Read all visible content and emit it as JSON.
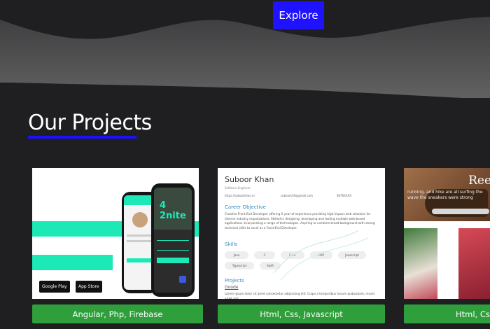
{
  "hero": {
    "explore_label": "Explore"
  },
  "projects": {
    "title": "Our Projects",
    "cards": [
      {
        "tech_label": "Angular, Php, Firebase",
        "app_name": "4 2nite",
        "badges": [
          "Google Play",
          "App Store"
        ]
      },
      {
        "tech_label": "Html, Css, Javascript",
        "resume": {
          "name": "Suboor Khan",
          "subtitle": "Software Engineer",
          "contacts": [
            "https://suboorkhan.in",
            "suboork56@gmail.com",
            "9876XXXX"
          ],
          "objective_heading": "Career Objective",
          "objective_text": "Creative Front-End Developer offering 2 year of experience providing high-impact web solutions for diverse industry organizations. Skilled in designing, developing and testing multiple web-based applications incorporating a range of technologies. Aspiring to combine broad background with strong technical skills to excel as a Front-End Developer.",
          "skills_heading": "Skills",
          "skills": [
            "Java",
            "C",
            "C++",
            "PHP",
            "Javascript",
            "Typescript",
            "Swift"
          ],
          "projects_heading": "Projects",
          "project_name": "Goode",
          "project_text": "Lorem ipsum dolor sit amet consectetur adipisicing elit. Culpa a temporibus harum quibusdam, rerum amet sint"
        }
      },
      {
        "tech_label": "Html, Css, Javascript",
        "preview_title": "Ree",
        "preview_text": "running, and hike are all surfing the wave the sneakers were strong"
      }
    ]
  },
  "colors": {
    "background": "#1f1f21",
    "hero_wave": "#5a5a5a",
    "explore": "#1f12ff",
    "underline": "#1a0fff",
    "tech_button": "#2e9f3b",
    "mint": "#1de9b6"
  }
}
